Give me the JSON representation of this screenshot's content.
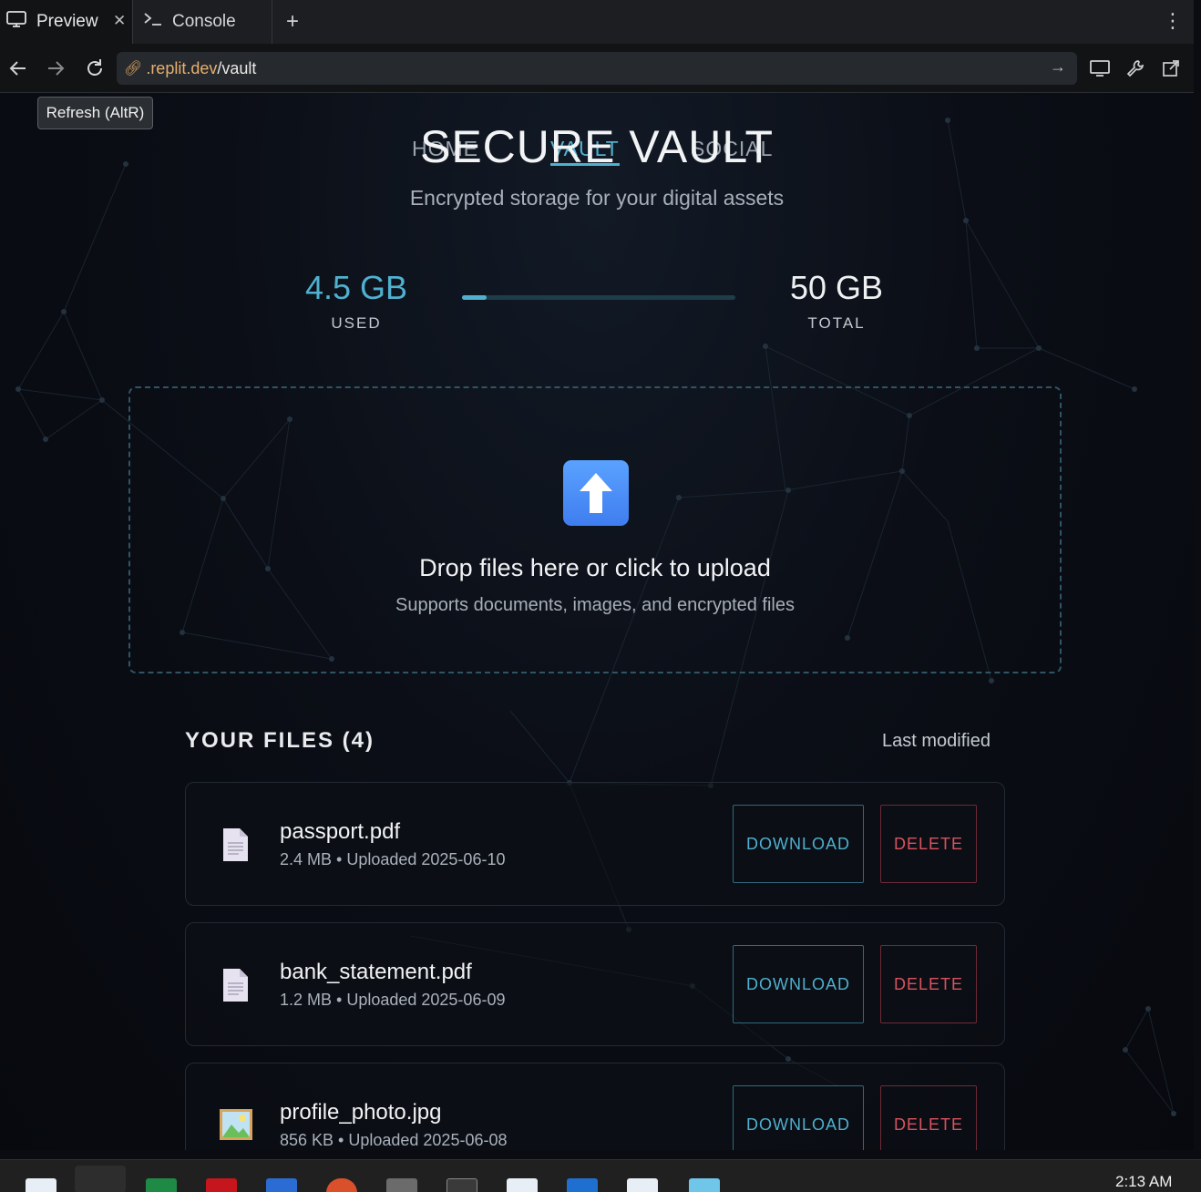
{
  "browser": {
    "tabs": [
      {
        "label": "Preview",
        "icon": "monitor-icon",
        "active": true
      },
      {
        "label": "Console",
        "icon": "terminal-icon",
        "active": false
      }
    ],
    "url_domain": ".replit.dev",
    "url_path": "/vault",
    "tooltip": "Refresh (AltR)"
  },
  "nav": {
    "links": [
      "HOME",
      "VAULT",
      "SOCIAL"
    ],
    "active": "VAULT"
  },
  "header": {
    "title": "SECURE VAULT",
    "subtitle": "Encrypted storage for your digital assets"
  },
  "storage": {
    "used_value": "4.5 GB",
    "used_label": "USED",
    "total_value": "50 GB",
    "total_label": "TOTAL",
    "used_fraction": 0.09
  },
  "upload": {
    "title": "Drop files here or click to upload",
    "subtitle": "Supports documents, images, and encrypted files",
    "icon": "upload-arrow-icon"
  },
  "files": {
    "heading": "YOUR FILES (4)",
    "sort_label": "Last modified",
    "download_label": "DOWNLOAD",
    "delete_label": "DELETE",
    "items": [
      {
        "name": "passport.pdf",
        "meta": "2.4 MB • Uploaded 2025-06-10",
        "icon": "document-icon"
      },
      {
        "name": "bank_statement.pdf",
        "meta": "1.2 MB • Uploaded 2025-06-09",
        "icon": "document-icon"
      },
      {
        "name": "profile_photo.jpg",
        "meta": "856 KB • Uploaded 2025-06-08",
        "icon": "image-icon"
      }
    ]
  },
  "taskbar": {
    "clock": "2:13 AM"
  },
  "colors": {
    "accent": "#4fb0cf",
    "danger": "#d9535f",
    "background": "#0a0c12"
  }
}
